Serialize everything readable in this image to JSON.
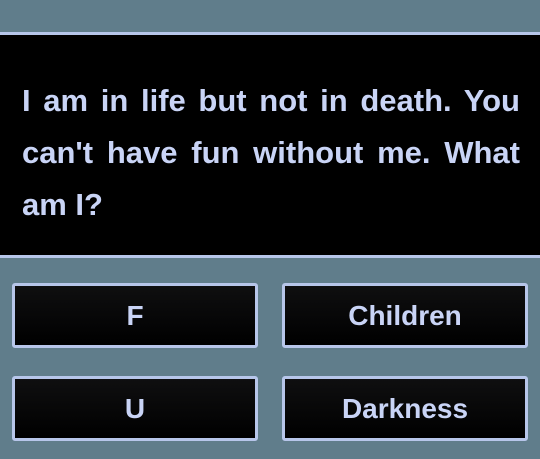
{
  "question": {
    "text": "I am in life but not in death. You can't have fun without me. What am I?"
  },
  "answers": [
    {
      "label": "F"
    },
    {
      "label": "Children"
    },
    {
      "label": "U"
    },
    {
      "label": "Darkness"
    }
  ],
  "colors": {
    "background": "#607d8b",
    "panel": "#000000",
    "border": "#b7c6ea",
    "text": "#c9d4f6"
  }
}
